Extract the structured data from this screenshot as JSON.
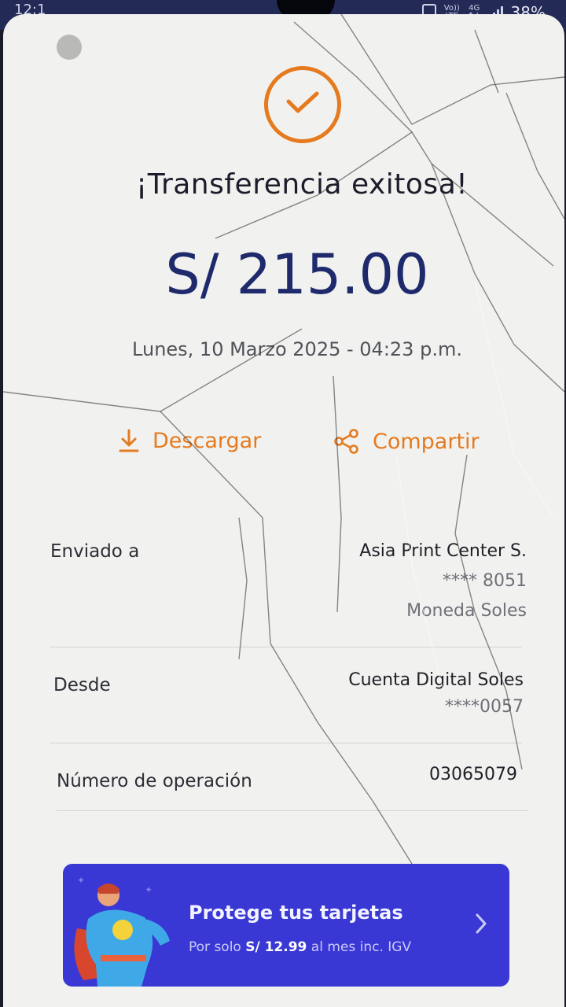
{
  "status_bar": {
    "time": "12:1",
    "network_top": "Vo))",
    "network_bottom": "LTE",
    "gen_top": "4G",
    "gen_bottom": "↑↓",
    "battery": "38%"
  },
  "header": {
    "title": "¡Transferencia exitosa!",
    "amount": "S/ 215.00",
    "datetime": "Lunes, 10 Marzo 2025 - 04:23 p.m."
  },
  "actions": {
    "download_label": "Descargar",
    "share_label": "Compartir",
    "download_icon": "download-icon",
    "share_icon": "share-icon"
  },
  "details": {
    "sent_to": {
      "label": "Enviado a",
      "name": "Asia Print Center S.",
      "account": "**** 8051",
      "currency": "Moneda Soles"
    },
    "from": {
      "label": "Desde",
      "account_name": "Cuenta Digital Soles",
      "account": "****0057"
    },
    "operation": {
      "label": "Número de operación",
      "number": "03065079"
    }
  },
  "promo": {
    "title": "Protege tus tarjetas",
    "subtitle_prefix": "Por solo ",
    "price": "S/ 12.99",
    "subtitle_suffix": " al mes inc. IGV",
    "chevron_icon": "chevron-right-icon"
  },
  "colors": {
    "accent": "#e57a1f",
    "amount": "#1e2a6c",
    "banner": "#3a38d4",
    "status_bar": "#232a55"
  }
}
